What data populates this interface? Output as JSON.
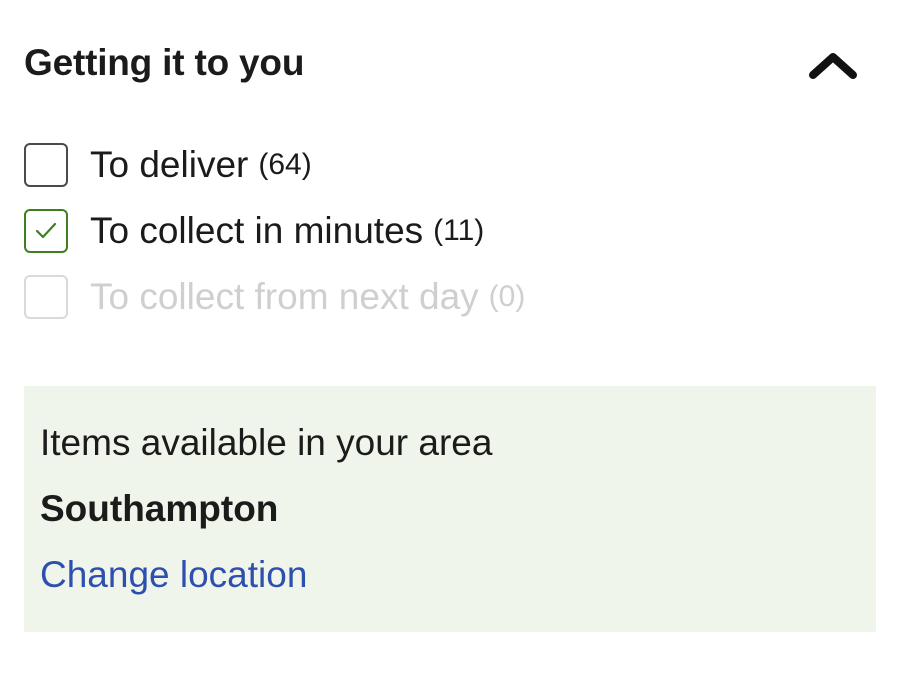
{
  "filter": {
    "title": "Getting it to you",
    "toggle_icon": "chevron-up-icon",
    "options": [
      {
        "label": "To deliver",
        "count": "(64)",
        "checked": false,
        "disabled": false
      },
      {
        "label": "To collect in minutes",
        "count": "(11)",
        "checked": true,
        "disabled": false
      },
      {
        "label": "To collect from next day",
        "count": "(0)",
        "checked": false,
        "disabled": true
      }
    ]
  },
  "location": {
    "heading": "Items available in your area",
    "name": "Southampton",
    "change_link": "Change location"
  },
  "colors": {
    "text": "#1b1b1b",
    "checkbox_checked": "#3f7f1f",
    "disabled_text": "#cfcfcf",
    "link": "#2e4fae",
    "panel_background": "#eff5ea"
  }
}
